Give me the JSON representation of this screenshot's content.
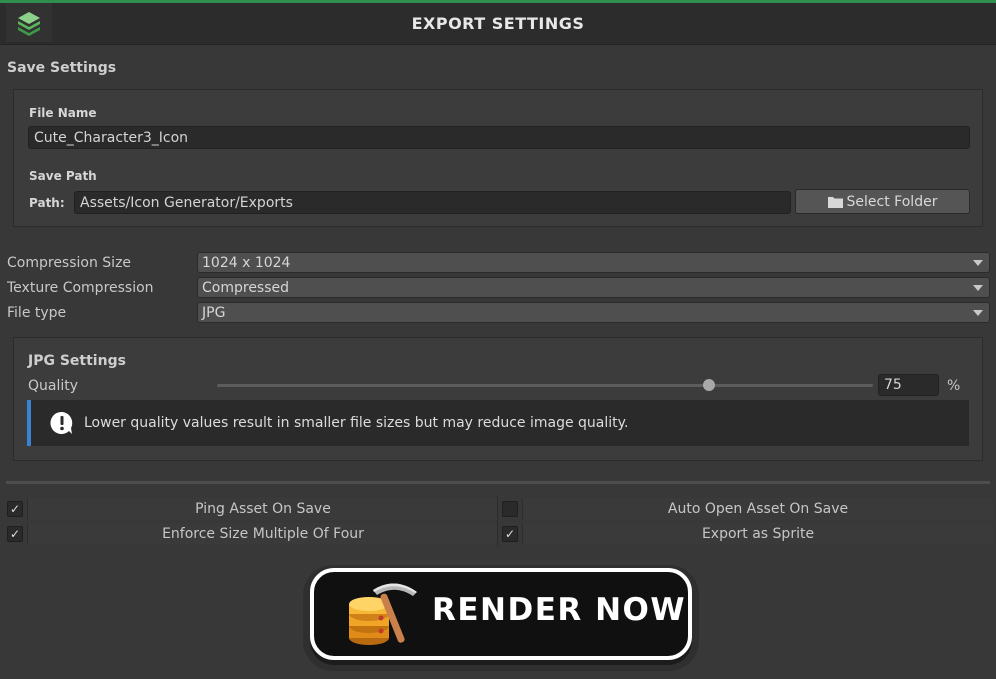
{
  "header": {
    "title": "EXPORT SETTINGS"
  },
  "save_settings": {
    "section_label": "Save Settings",
    "file_name_label": "File Name",
    "file_name_value": "Cute_Character3_Icon",
    "save_path_label": "Save Path",
    "path_label": "Path:",
    "path_value": "Assets/Icon Generator/Exports",
    "select_folder_label": "Select Folder"
  },
  "fields": [
    {
      "label": "Compression Size",
      "value": "1024 x 1024"
    },
    {
      "label": "Texture Compression",
      "value": "Compressed"
    },
    {
      "label": "File type",
      "value": "JPG"
    }
  ],
  "jpg_settings": {
    "section_label": "JPG Settings",
    "quality_label": "Quality",
    "quality_value": "75",
    "quality_unit": "%",
    "quality_fraction": 0.75,
    "info_text": "Lower quality values result in smaller file sizes but may reduce image quality."
  },
  "options": [
    {
      "label": "Ping Asset On Save",
      "checked": true
    },
    {
      "label": "Auto Open Asset On Save",
      "checked": false
    },
    {
      "label": "Enforce Size Multiple Of Four",
      "checked": true
    },
    {
      "label": "Export as Sprite",
      "checked": true
    }
  ],
  "render": {
    "label": "RENDER NOW"
  },
  "colors": {
    "accent_green": "#2f8f4c",
    "info_blue": "#3c82d2",
    "background": "#383838"
  },
  "icons": {
    "logo": "layers-icon",
    "folder": "folder-icon",
    "info": "warning-bubble-icon",
    "render": "pickaxe-database-icon",
    "dropdown": "triangle-down-icon",
    "check": "check-icon"
  }
}
